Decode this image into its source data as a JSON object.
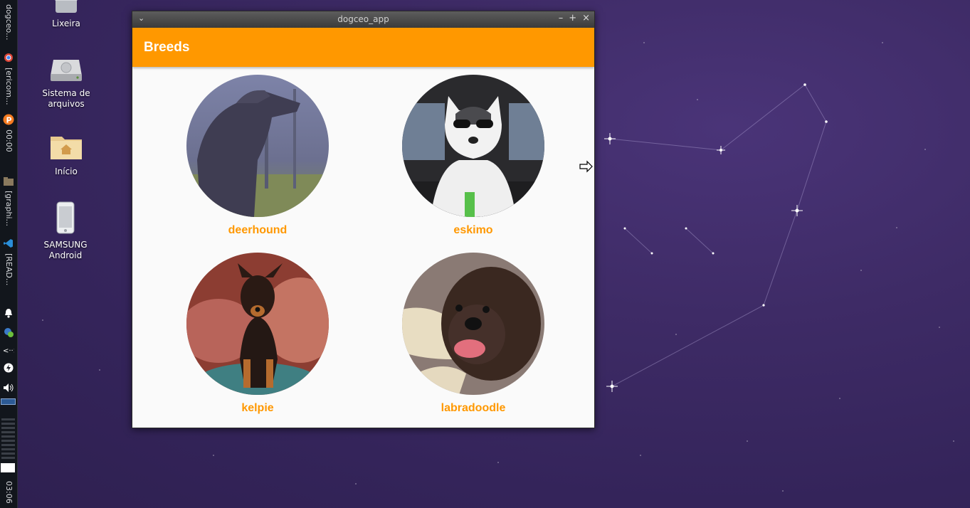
{
  "window": {
    "title": "dogceo_app",
    "appbar_title": "Breeds",
    "menu_glyph": "⌄",
    "controls": [
      "–",
      "+",
      "×"
    ]
  },
  "breeds": [
    {
      "name": "deerhound"
    },
    {
      "name": "eskimo"
    },
    {
      "name": "kelpie"
    },
    {
      "name": "labradoodle"
    }
  ],
  "desktop": {
    "icons": [
      {
        "label": "Lixeira",
        "icon": "trash-icon"
      },
      {
        "label": "Sistema de arquivos",
        "icon": "drive-icon"
      },
      {
        "label": "Início",
        "icon": "home-folder-icon"
      },
      {
        "label": "SAMSUNG Android",
        "icon": "phone-icon"
      }
    ]
  },
  "panel": {
    "task_1": "dogceo...",
    "task_2": "[ericom...",
    "clock_top": "00:00",
    "task_3": "[graphi...",
    "task_4": "[READ...",
    "clock_bottom": "03:06"
  },
  "colors": {
    "accent": "#ff9800",
    "window_bg": "#fafafa",
    "desktop": "#3e2b66"
  }
}
